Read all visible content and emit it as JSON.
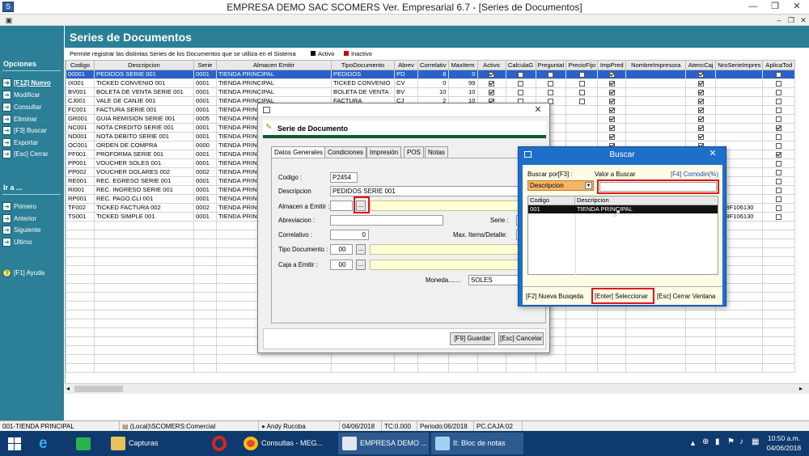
{
  "window": {
    "title": "EMPRESA DEMO SAC        SCOMERS Ver. Empresarial  6.7 - [Series de Documentos]"
  },
  "page": {
    "title": "Series de Documentos",
    "info": "Permite registrar las distintas Series de los Documentos que se utiliza en el Sistema",
    "legend_active": "Activo",
    "legend_inactive": "Inactivo",
    "active_color": "#000000",
    "inactive_color": "#cc0000"
  },
  "sidebar": {
    "options_heading": "Opciones",
    "options": [
      "[F12] Nuevo",
      "Modificar",
      "Consultar",
      "Eliminar",
      "[F3] Buscar",
      "Exportar",
      "[Esc] Cerrar"
    ],
    "goto_heading": "Ir a ...",
    "goto": [
      "Primero",
      "Anterior",
      "Siguiente",
      "Ultimo"
    ],
    "help": "[F1] Ayuda"
  },
  "grid": {
    "columns": [
      "Codigo",
      "Descripcion",
      "Serie",
      "Almacen Emitir",
      "TipoDocumento",
      "Abrev",
      "Correlativ",
      "MaxItem",
      "Activo",
      "CalculaG",
      "PreguntaI",
      "PrecioFijo",
      "ImpPred",
      "NombreImpresora",
      "AtencCaj",
      "NroSerieImpres",
      "AplicaTod"
    ],
    "rows": [
      [
        "00001",
        "PEDIDOS SERIE 001",
        "0001",
        "TIENDA PRINCIPAL",
        "PEDIDOS",
        "PD",
        "8",
        "0",
        "1",
        "0",
        "0",
        "0",
        "1",
        "",
        "1",
        "",
        "0"
      ],
      [
        "IX001",
        "TICKED CONVENIO 001",
        "0001",
        "TIENDA PRINCIPAL",
        "TICKED CONVENIO",
        "CV",
        "0",
        "99",
        "1",
        "0",
        "0",
        "0",
        "1",
        "",
        "1",
        "",
        "0"
      ],
      [
        "BV001",
        "BOLETA DE VENTA SERIE 001",
        "0001",
        "TIENDA PRINCIPAL",
        "BOLETA DE VENTA",
        "BV",
        "10",
        "10",
        "1",
        "0",
        "0",
        "0",
        "1",
        "",
        "1",
        "",
        "0"
      ],
      [
        "CJ001",
        "VALE DE CANJE 001",
        "0001",
        "TIENDA PRINCIPAL",
        "FACTURA",
        "CJ",
        "2",
        "10",
        "1",
        "0",
        "0",
        "0",
        "1",
        "",
        "1",
        "",
        "0"
      ],
      [
        "FC001",
        "FACTURA SERIE 001",
        "0001",
        "TIENDA PRIN",
        "",
        "",
        "",
        "",
        "",
        "",
        "",
        "",
        "1",
        "",
        "1",
        "",
        "0"
      ],
      [
        "GR001",
        "GUIA REMISION SERIE 001",
        "0005",
        "TIENDA PRIN",
        "",
        "",
        "",
        "",
        "",
        "",
        "",
        "",
        "1",
        "",
        "1",
        "",
        "0"
      ],
      [
        "NC001",
        "NOTA CREDITO SERIE 001",
        "0001",
        "TIENDA PRIN",
        "",
        "",
        "",
        "",
        "",
        "",
        "",
        "",
        "1",
        "",
        "1",
        "",
        "1"
      ],
      [
        "ND001",
        "NOTA DEBITO SERIE 001",
        "0001",
        "TIENDA PRIN",
        "",
        "",
        "",
        "",
        "",
        "",
        "",
        "",
        "1",
        "",
        "1",
        "",
        "0"
      ],
      [
        "OC001",
        "ORDEN DE COMPRA",
        "0000",
        "TIENDA PRIN",
        "",
        "",
        "",
        "",
        "",
        "",
        "",
        "",
        "1",
        "",
        "1",
        "",
        "0"
      ],
      [
        "PF001",
        "PROFORMA SERIE 001",
        "0001",
        "TIENDA PRIN",
        "",
        "",
        "",
        "",
        "",
        "",
        "",
        "",
        "1",
        "",
        "1",
        "",
        "1"
      ],
      [
        "PP001",
        "VOUCHER SOLES 001",
        "0001",
        "TIENDA PRIN",
        "",
        "",
        "",
        "",
        "",
        "",
        "",
        "",
        "1",
        "",
        "1",
        "",
        "0"
      ],
      [
        "PP002",
        "VOUCHER DOLARES 002",
        "0002",
        "TIENDA PRIN",
        "",
        "",
        "",
        "",
        "",
        "",
        "",
        "",
        "1",
        "",
        "1",
        "",
        "0"
      ],
      [
        "RE001",
        "REC. EGRESO SERIE 001",
        "0001",
        "TIENDA PRIN",
        "",
        "",
        "",
        "",
        "",
        "",
        "",
        "",
        "1",
        "",
        "1",
        "",
        "0"
      ],
      [
        "RI001",
        "REC. INGRESO SERIE 001",
        "0001",
        "TIENDA PRIN",
        "",
        "",
        "",
        "",
        "",
        "",
        "",
        "",
        "1",
        "",
        "1",
        "",
        "0"
      ],
      [
        "RP001",
        "REC. PAGO.CLI 001",
        "0001",
        "TIENDA PRIN",
        "",
        "",
        "",
        "",
        "",
        "",
        "",
        "",
        "1",
        "",
        "1",
        "",
        "0"
      ],
      [
        "TF002",
        "TICKED FACTURA 002",
        "0002",
        "TIENDA PRIN",
        "",
        "",
        "",
        "",
        "",
        "",
        "",
        "",
        "1",
        "",
        "1",
        "FFBF106130",
        "0"
      ],
      [
        "TS001",
        "TICKED SIMPLE 001",
        "0001",
        "TIENDA PRIN",
        "",
        "",
        "",
        "",
        "",
        "",
        "",
        "",
        "1",
        "",
        "1",
        "FFBF106130",
        "0"
      ]
    ]
  },
  "serie_dialog": {
    "title": "Serie de Documento",
    "tabs": [
      "Datos Generales",
      "Condiciones",
      "Impresión",
      "POS",
      "Notas"
    ],
    "codigo_label": "Codigo :",
    "codigo_value": "P2454",
    "descripcion_label": "Descripcion",
    "descripcion_value": "PEDIDOS SERIE 001",
    "almacen_label": "Almacen a Emitir :",
    "abreviacion_label": "Abreviacion :",
    "serie_label": "Serie :",
    "correlativo_label": "Correlativo :",
    "correlativo_value": "0",
    "max_items_label": "Max. Items/Detalle:",
    "tipo_doc_label": "Tipo Documento :",
    "tipo_doc_value": "00",
    "caja_label": "Caja a Emitir :",
    "caja_value": "00",
    "moneda_label": "Moneda.......",
    "moneda_value": "SOLES",
    "browse": "...",
    "save_button": "[F9] Guardar",
    "cancel_button": "[Esc] Cancelar"
  },
  "buscar_dialog": {
    "title": "Buscar",
    "buscar_por_label": "Buscar por[F3] :",
    "valor_label": "Valor a Buscar",
    "comodin_label": "[F4] Comodin(%)",
    "field_value": "Descripcion",
    "col_codigo": "Codigo",
    "col_descripcion": "Descripcion",
    "result_codigo": "001",
    "result_descripcion": "TIENDA PRINCIPAL",
    "new_search_button": "[F2] Nueva Busqeda",
    "select_button": "[Enter] Seleccionar",
    "close_button": "[Esc] Cerrar Ventana"
  },
  "statusbar": {
    "almacen": "001-TIENDA PRINCIPAL",
    "db": "(Local)\\SCOMERS:Comercial",
    "user": "Andy Rucoba",
    "date": "04/06/2018",
    "tc": "TC:0.000",
    "periodo": "Periodo:06/2018",
    "caja": "PC.CAJA:02"
  },
  "taskbar": {
    "items": [
      "Capturas",
      "Consultas - MEG...",
      "EMPRESA DEMO ...",
      "II: Bloc de notas"
    ],
    "time": "10:50 a.m.",
    "date": "04/06/2018"
  }
}
